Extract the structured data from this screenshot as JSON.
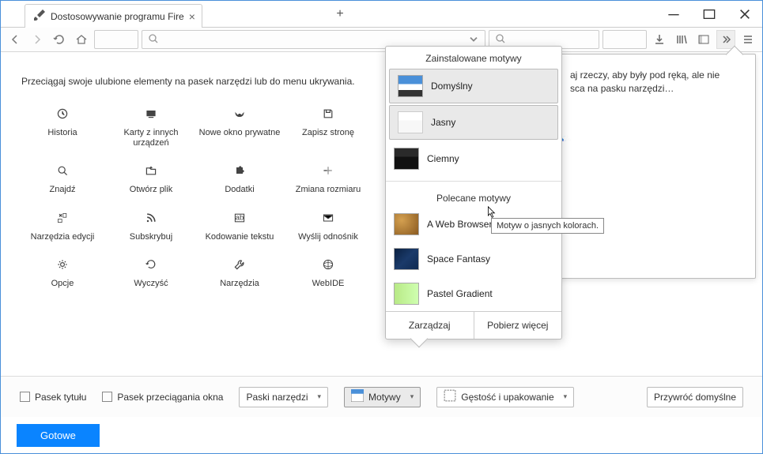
{
  "tab": {
    "title": "Dostosowywanie programu Fire"
  },
  "instruction": "Przeciągaj swoje ulubione elementy na pasek narzędzi lub do menu ukrywania.",
  "items": [
    {
      "icon": "history",
      "label": "Historia"
    },
    {
      "icon": "device",
      "label": "Karty z innych urządzeń"
    },
    {
      "icon": "mask",
      "label": "Nowe okno prywatne"
    },
    {
      "icon": "save",
      "label": "Zapisz stronę"
    },
    {
      "icon": "search",
      "label": "Znajdź"
    },
    {
      "icon": "open",
      "label": "Otwórz plik"
    },
    {
      "icon": "puzzle",
      "label": "Dodatki"
    },
    {
      "icon": "zoom",
      "label": "Zmiana rozmiaru"
    },
    {
      "icon": "edit",
      "label": "Narzędzia edycji"
    },
    {
      "icon": "rss",
      "label": "Subskrybuj"
    },
    {
      "icon": "encoding",
      "label": "Kodowanie tekstu"
    },
    {
      "icon": "mail",
      "label": "Wyślij odnośnik"
    },
    {
      "icon": "gear",
      "label": "Opcje"
    },
    {
      "icon": "clear",
      "label": "Wyczyść"
    },
    {
      "icon": "wrench",
      "label": "Narzędzia"
    },
    {
      "icon": "webide",
      "label": "WebIDE"
    }
  ],
  "panel": {
    "line1": "aj rzeczy, aby były pod ręką, ale nie",
    "line2": "sca na pasku narzędzi…"
  },
  "popup": {
    "installed": "Zainstalowane motywy",
    "themes": [
      {
        "name": "Domyślny",
        "sw": "def",
        "sel": true
      },
      {
        "name": "Jasny",
        "sw": "light",
        "sel": true
      },
      {
        "name": "Ciemny",
        "sw": "dark",
        "sel": false
      }
    ],
    "recommended": "Polecane motywy",
    "recs": [
      {
        "name": "A Web Browser Renaissance",
        "sw": "ren"
      },
      {
        "name": "Space Fantasy",
        "sw": "sf"
      },
      {
        "name": "Pastel Gradient",
        "sw": "pg"
      }
    ],
    "manage": "Zarządzaj",
    "more": "Pobierz więcej"
  },
  "tooltip": "Motyw o jasnych kolorach.",
  "footer": {
    "titlebar": "Pasek tytułu",
    "dragspace": "Pasek przeciągania okna",
    "toolbars": "Paski narzędzi",
    "themes": "Motywy",
    "density": "Gęstość i upakowanie",
    "restore": "Przywróć domyślne"
  },
  "done": "Gotowe"
}
